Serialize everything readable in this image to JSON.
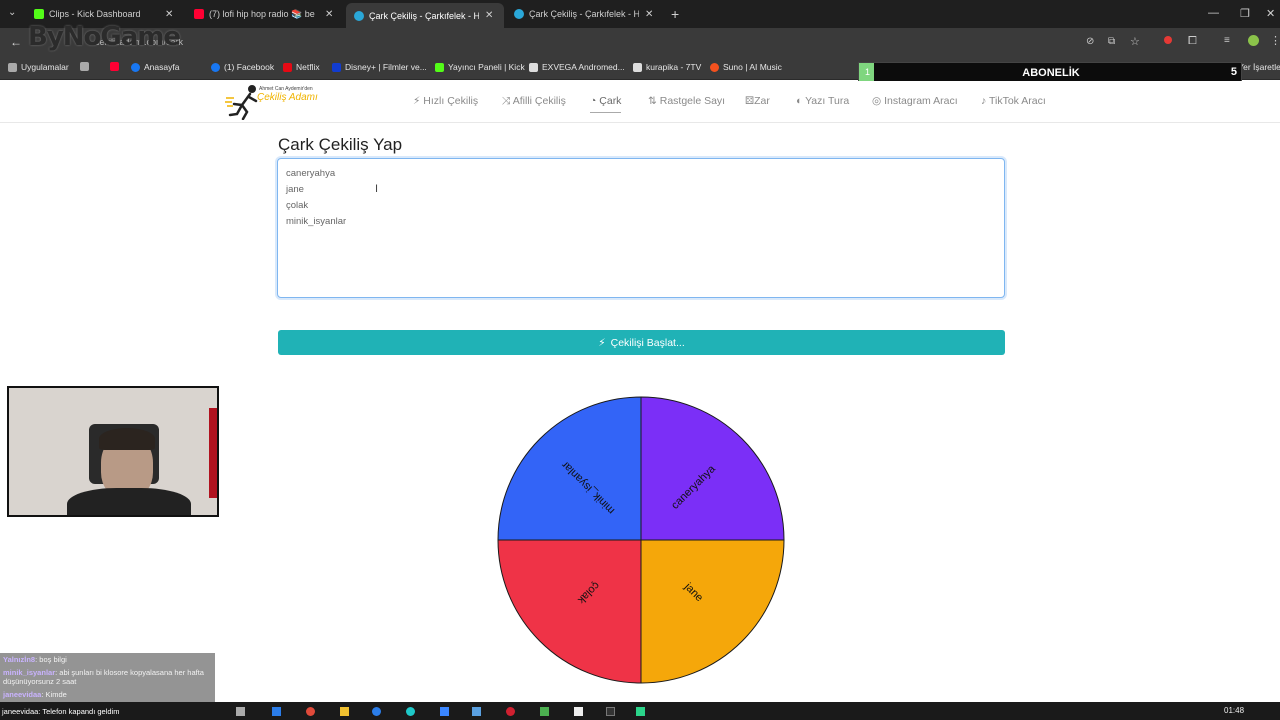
{
  "browser": {
    "tabs": [
      {
        "title": "Clips - Kick Dashboard",
        "color": "#53fc18"
      },
      {
        "title": "(7) lofi hip hop radio 📚 be",
        "color": "#ff0033"
      },
      {
        "title": "Çark Çekiliş - Çarkıfelek - H",
        "color": "#2aa7d8"
      },
      {
        "title": "Çark Çekiliş - Çarkıfelek - Hızlı Ç",
        "color": "#2aa7d8"
      }
    ],
    "window_controls": {
      "minimize": "—",
      "maximize": "❐",
      "close": "✕"
    },
    "address_text": "cekilisadami.com/cark"
  },
  "bookmarks": [
    {
      "label": "Uygulamalar",
      "color": "#aaaaaa"
    },
    {
      "label": "",
      "color": "#aaaaaa"
    },
    {
      "label": "",
      "color": "#ff0033"
    },
    {
      "label": "Anasayfa",
      "color": "#1877f2"
    },
    {
      "label": "(1) Facebook",
      "color": "#1877f2"
    },
    {
      "label": "Netflix",
      "color": "#e50914"
    },
    {
      "label": "Disney+ | Filmler ve...",
      "color": "#113ccf"
    },
    {
      "label": "Yayıncı Paneli | Kick",
      "color": "#53fc18"
    },
    {
      "label": "EXVEGA Andromed...",
      "color": "#dddddd"
    },
    {
      "label": "kurapika - 7TV",
      "color": "#dddddd"
    },
    {
      "label": "Suno | AI Music",
      "color": "#f4511e"
    },
    {
      "label": "Tüm Yer İşaretleri",
      "color": "#888888"
    }
  ],
  "stream_logo": "ByNoGame",
  "subscription": {
    "label": "ABONELİK",
    "current": "1",
    "goal": "5",
    "progress": 0.2
  },
  "site": {
    "logo_line1": "Ahmet Can Aydemir'den",
    "logo_line2": "Çekiliş Adamı",
    "nav": [
      {
        "label": "Hızlı Çekiliş",
        "icon": "bolt-icon"
      },
      {
        "label": "Afilli Çekiliş",
        "icon": "shuffle-icon"
      },
      {
        "label": "Çark",
        "icon": "pie-icon"
      },
      {
        "label": "Rastgele Sayı",
        "icon": "sort-icon"
      },
      {
        "label": "Zar",
        "icon": "dice-icon"
      },
      {
        "label": "Yazı Tura",
        "icon": "coin-icon"
      },
      {
        "label": "Instagram Aracı",
        "icon": "instagram-icon"
      },
      {
        "label": "TikTok Aracı",
        "icon": "tiktok-icon"
      }
    ],
    "active_nav": "Çark"
  },
  "main": {
    "title": "Çark Çekiliş Yap",
    "names": [
      "caneryahya",
      "jane",
      "çolak",
      "minik_isyanlar"
    ],
    "start_button": "Çekilişi Başlat..."
  },
  "wheel": {
    "segments": [
      {
        "label": "caneryahya",
        "color": "#7b2ff7"
      },
      {
        "label": "jane",
        "color": "#f5a70a"
      },
      {
        "label": "çolak",
        "color": "#ef3347"
      },
      {
        "label": "minik_isyanlar",
        "color": "#3364f7"
      }
    ]
  },
  "chat": [
    {
      "user": "Yalnızİn8",
      "message": "boş bilgi"
    },
    {
      "user": "minik_isyanlar",
      "message": "abi şunları bi klosore kopyalasana her hafta düşünüyorsunz 2 saat"
    },
    {
      "user": "janeevidaa",
      "message": "Kimde"
    },
    {
      "user": "janeevidaa",
      "message": "Telefon kapandı geldim"
    }
  ],
  "clock": "01:48"
}
